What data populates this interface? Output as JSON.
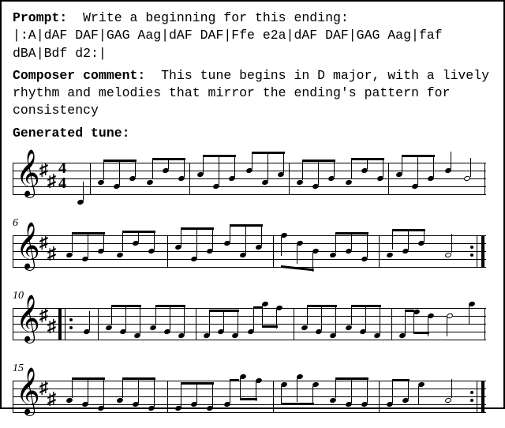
{
  "prompt_label": "Prompt:",
  "prompt_text": "  Write a beginning for this ending:\n|:A|dAF DAF|GAG Aag|dAF DAF|Ffe e2a|dAF DAF|GAG Aag|faf dBA|Bdf d2:|",
  "composer_label": "Composer comment:",
  "composer_text": "  This tune begins in D major, with a lively rhythm and melodies that mirror the ending's pattern for consistency",
  "generated_label": "Generated tune:",
  "chart_data": {
    "type": "music-score",
    "key": "D major",
    "time_signature": "4/4",
    "clef": "treble",
    "systems": [
      {
        "bar_number": null,
        "bars": 5,
        "starts_repeat": false,
        "ends_repeat": false
      },
      {
        "bar_number": 6,
        "bars": 4,
        "starts_repeat": false,
        "ends_repeat": true
      },
      {
        "bar_number": 10,
        "bars": 5,
        "starts_repeat": true,
        "ends_repeat": false
      },
      {
        "bar_number": 15,
        "bars": 4,
        "starts_repeat": false,
        "ends_repeat": true
      }
    ],
    "abc_context": "|:A|dAF DAF|GAG Aag|dAF DAF|Ffe e2a|dAF DAF|GAG Aag|faf dBA|Bdf d2:|"
  }
}
